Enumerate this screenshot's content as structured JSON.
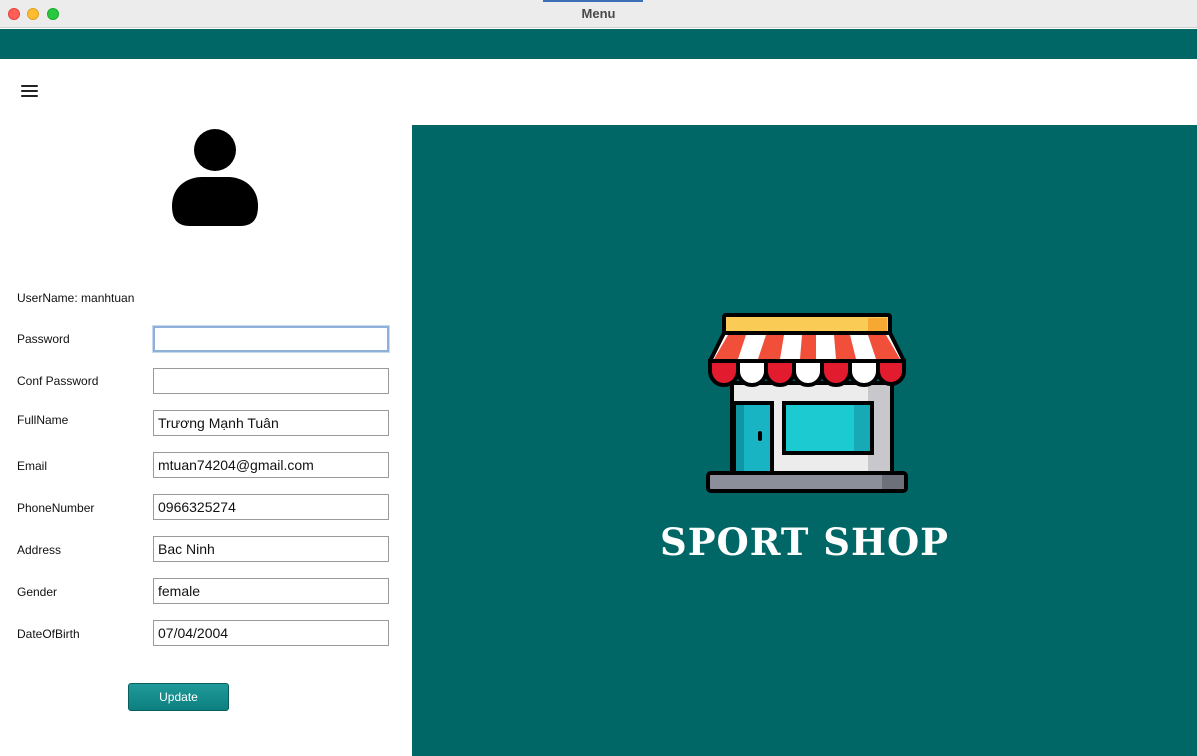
{
  "window": {
    "title": "Menu"
  },
  "profile": {
    "username_label": "UserName:",
    "username_value": "manhtuan",
    "fields": [
      {
        "label": "Password",
        "value": ""
      },
      {
        "label": "Conf Password",
        "value": ""
      },
      {
        "label": "FullName",
        "value": "Trương Mạnh Tuân"
      },
      {
        "label": "Email",
        "value": "mtuan74204@gmail.com"
      },
      {
        "label": "PhoneNumber",
        "value": "0966325274"
      },
      {
        "label": "Address",
        "value": "Bac Ninh"
      },
      {
        "label": "Gender",
        "value": "female"
      },
      {
        "label": "DateOfBirth",
        "value": "07/04/2004"
      }
    ],
    "update_label": "Update"
  },
  "banner": {
    "title": "SPORT SHOP"
  },
  "icons": [
    "menu-icon",
    "user-avatar-icon",
    "shop-storefront-icon"
  ],
  "colors": {
    "accent": "#006666",
    "button": "#0d7f80"
  }
}
